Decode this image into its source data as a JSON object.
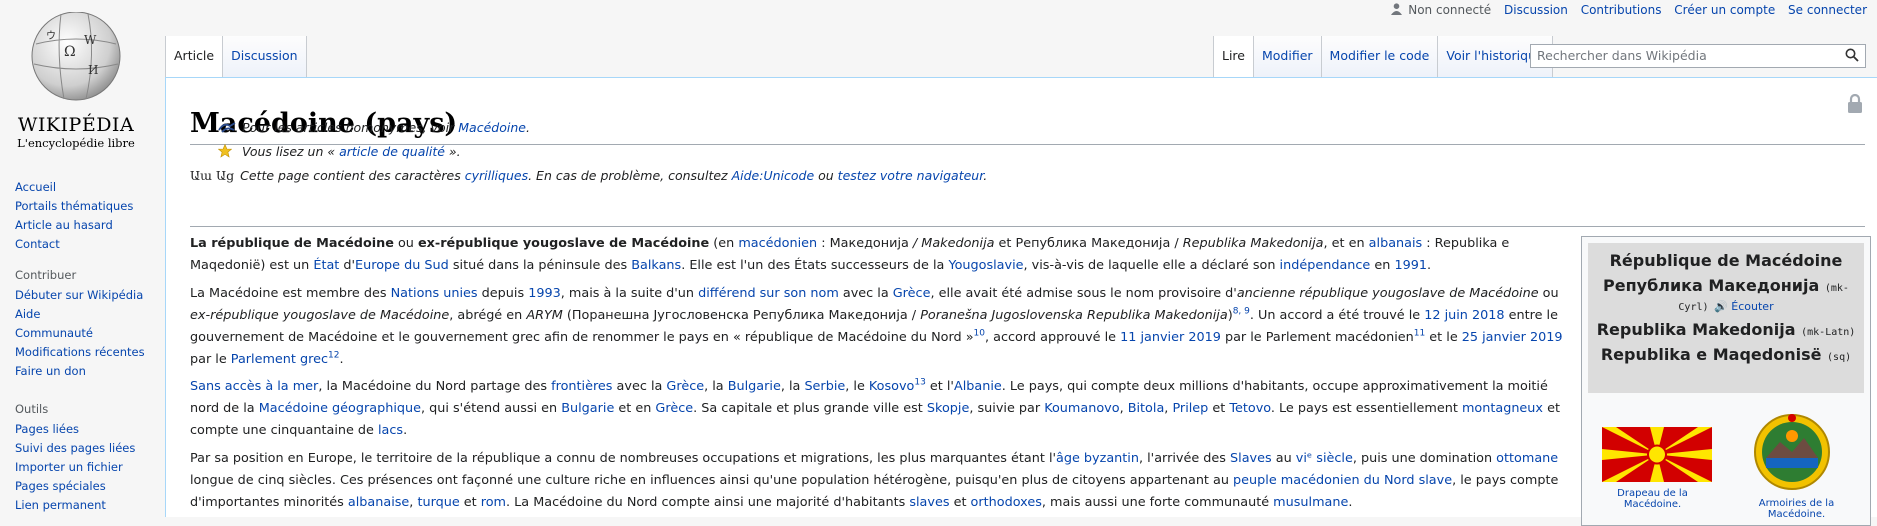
{
  "logo": {
    "wordmark": "WIKIPÉDIA",
    "tagline": "L'encyclopédie libre"
  },
  "sidebar": {
    "nav": [
      "Accueil",
      "Portails thématiques",
      "Article au hasard",
      "Contact"
    ],
    "contribuer": {
      "heading": "Contribuer",
      "items": [
        "Débuter sur Wikipédia",
        "Aide",
        "Communauté",
        "Modifications récentes",
        "Faire un don"
      ]
    },
    "outils": {
      "heading": "Outils",
      "items": [
        "Pages liées",
        "Suivi des pages liées",
        "Importer un fichier",
        "Pages spéciales",
        "Lien permanent"
      ]
    }
  },
  "personal": {
    "not_connected": "Non connecté",
    "links": [
      "Discussion",
      "Contributions",
      "Créer un compte",
      "Se connecter"
    ]
  },
  "tabs_left": [
    "Article",
    "Discussion"
  ],
  "tabs_right": [
    "Lire",
    "Modifier",
    "Modifier le code",
    "Voir l'historique"
  ],
  "search": {
    "placeholder": "Rechercher dans Wikipédia"
  },
  "article": {
    "title": "Macédoine (pays)",
    "hatnote1": {
      "text": "Pour les articles homonymes, voir ",
      "link": "Macédoine",
      "end": "."
    },
    "hatnote2": {
      "a": "Vous lisez un « ",
      "link": "article de qualité",
      "b": " »."
    },
    "hatnote3": {
      "glyph": "Աա Աց",
      "a": "Cette page contient des caractères ",
      "l1": "cyrilliques",
      "b": ". En cas de problème, consultez ",
      "l2": "Aide:Unicode",
      "c": " ou ",
      "l3": "testez votre navigateur",
      "d": "."
    }
  },
  "infobox": {
    "name_fr": "République de Macédoine",
    "name_mk_cyrl": "Република Македонија",
    "code_cyrl": "(mk-Cyrl)",
    "listen": "🔊 Écouter",
    "name_mk_latn": "Republika Makedonija",
    "code_latn": "(mk-Latn)",
    "name_sq": "Republika e Maqedonisë",
    "code_sq": "(sq)",
    "flag_caption": "Drapeau de la Macédoine.",
    "arms_caption": "Armoiries de la Macédoine.",
    "flag_colors": {
      "red": "#d20000",
      "yellow": "#ffe600"
    }
  }
}
